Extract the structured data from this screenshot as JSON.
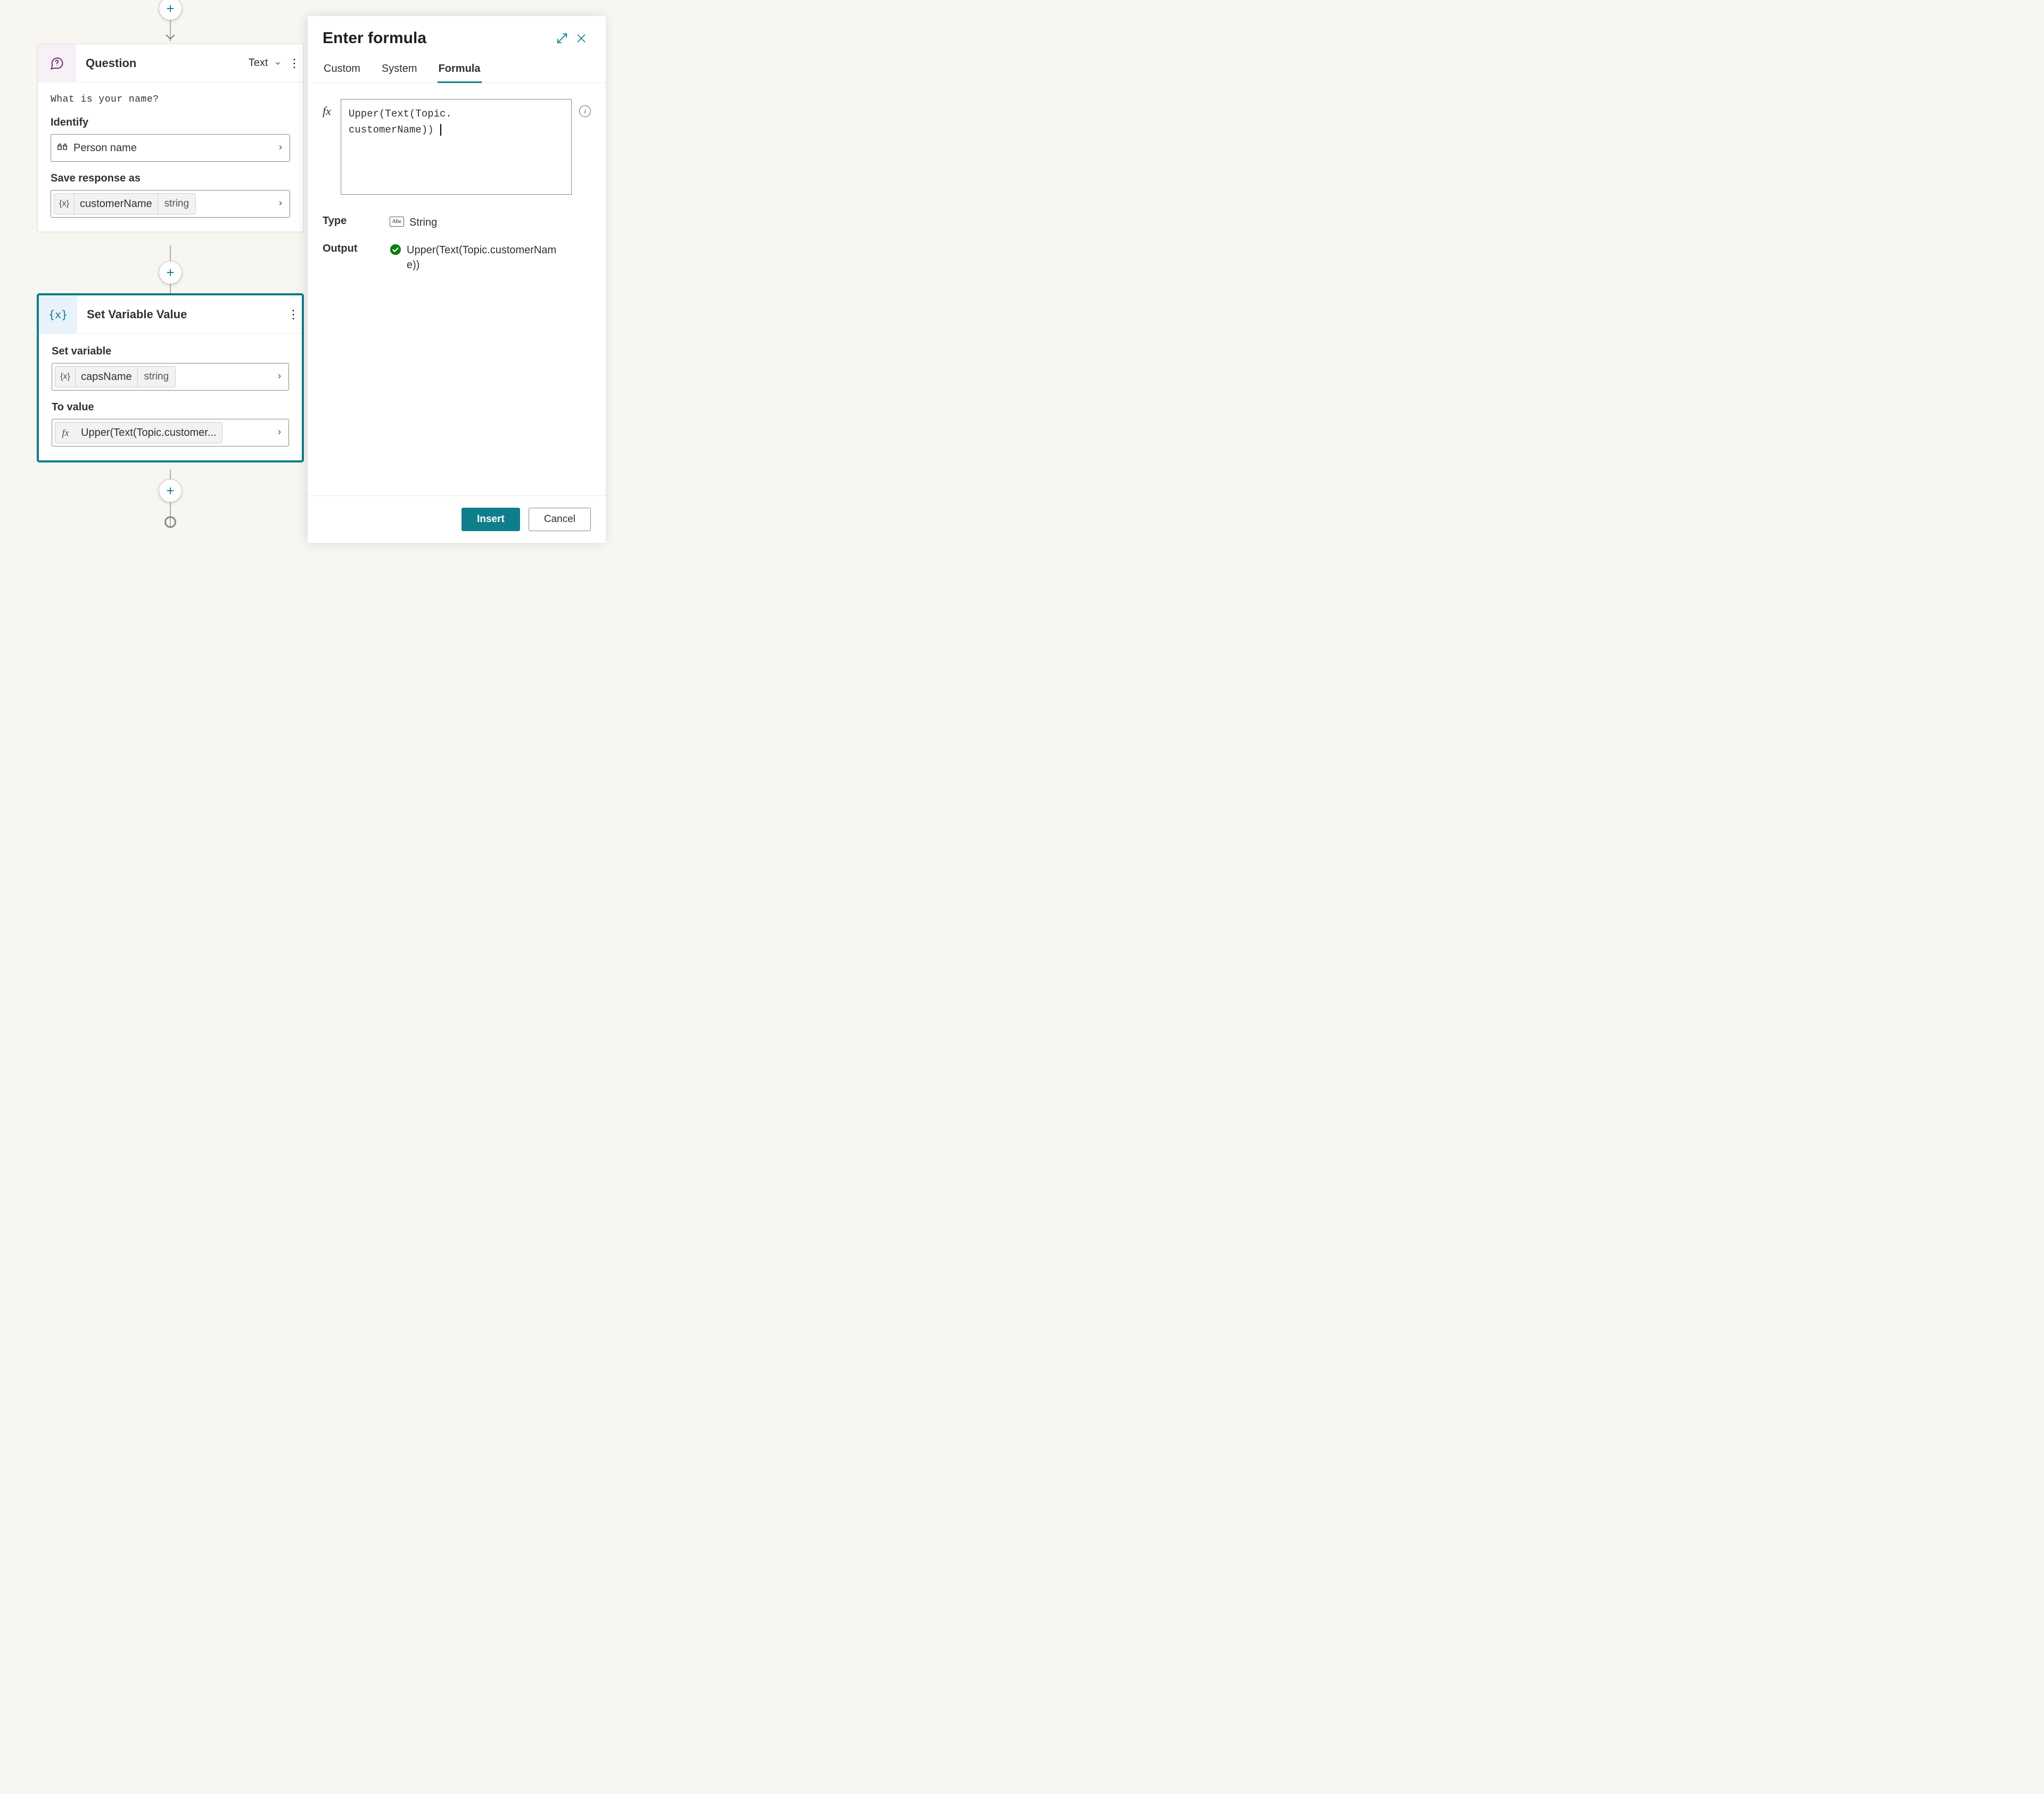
{
  "canvas": {
    "question_card": {
      "title": "Question",
      "type_label": "Text",
      "prompt": "What is your name?",
      "identify_label": "Identify",
      "identify_value": "Person name",
      "save_label": "Save response as",
      "variable_name": "customerName",
      "variable_type": "string"
    },
    "setvar_card": {
      "title": "Set Variable Value",
      "setvar_label": "Set variable",
      "variable_name": "capsName",
      "variable_type": "string",
      "tovalue_label": "To value",
      "formula_preview": "Upper(Text(Topic.customer..."
    }
  },
  "panel": {
    "title": "Enter formula",
    "tabs": {
      "custom": "Custom",
      "system": "System",
      "formula": "Formula"
    },
    "formula_line1": "Upper(Text(Topic.",
    "formula_line2": "customerName))",
    "type_label": "Type",
    "type_value": "String",
    "output_label": "Output",
    "output_value": "Upper(Text(Topic.customerName))",
    "insert_btn": "Insert",
    "cancel_btn": "Cancel"
  }
}
